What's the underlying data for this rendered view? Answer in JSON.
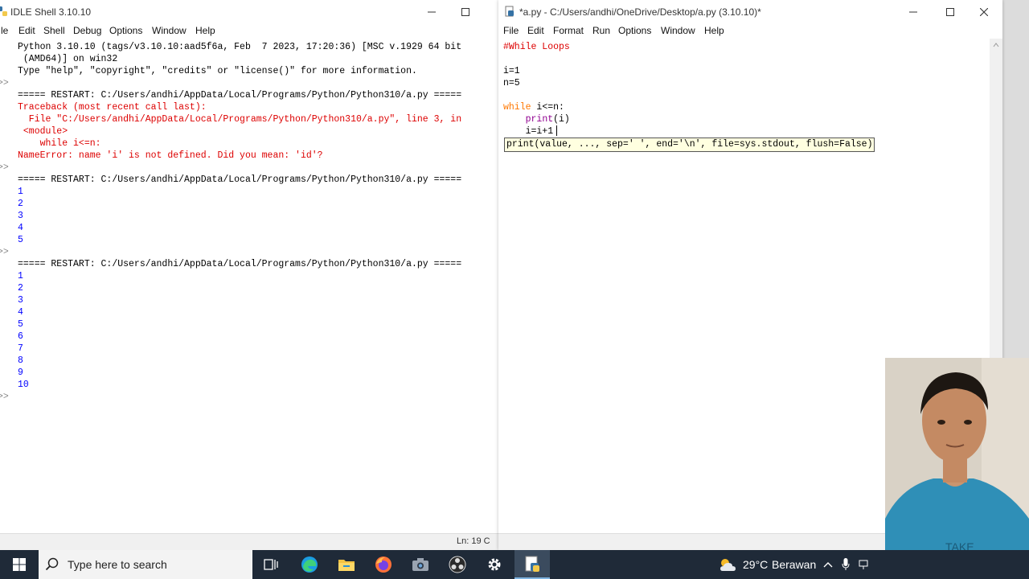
{
  "colors": {
    "keyword": "#ff7700",
    "comment": "#dd0000",
    "string": "#00aa00",
    "error": "#dd0000",
    "output": "#0000ff",
    "prompt": "#8a8a8a"
  },
  "shell": {
    "title": "IDLE Shell 3.10.10",
    "menu": [
      "le",
      "Edit",
      "Shell",
      "Debug",
      "Options",
      "Window",
      "Help"
    ],
    "status": "Ln: 19   C",
    "lines": [
      {
        "prompt": "",
        "text": "Python 3.10.10 (tags/v3.10.10:aad5f6a, Feb  7 2023, 17:20:36) [MSC v.1929 64 bit",
        "kind": "normal"
      },
      {
        "prompt": "",
        "text": " (AMD64)] on win32",
        "kind": "normal"
      },
      {
        "prompt": "",
        "text": "Type \"help\", \"copyright\", \"credits\" or \"license()\" for more information.",
        "kind": "normal"
      },
      {
        "prompt": ">>",
        "text": "",
        "kind": "normal"
      },
      {
        "prompt": "",
        "text": "===== RESTART: C:/Users/andhi/AppData/Local/Programs/Python/Python310/a.py =====",
        "kind": "normal"
      },
      {
        "prompt": "",
        "text": "Traceback (most recent call last):",
        "kind": "error"
      },
      {
        "prompt": "",
        "text": "  File \"C:/Users/andhi/AppData/Local/Programs/Python/Python310/a.py\", line 3, in",
        "kind": "error"
      },
      {
        "prompt": "",
        "text": " <module>",
        "kind": "error"
      },
      {
        "prompt": "",
        "text": "    while i<=n:",
        "kind": "error"
      },
      {
        "prompt": "",
        "text": "NameError: name 'i' is not defined. Did you mean: 'id'?",
        "kind": "error"
      },
      {
        "prompt": ">>",
        "text": "",
        "kind": "normal"
      },
      {
        "prompt": "",
        "text": "===== RESTART: C:/Users/andhi/AppData/Local/Programs/Python/Python310/a.py =====",
        "kind": "normal"
      },
      {
        "prompt": "",
        "text": "1",
        "kind": "output"
      },
      {
        "prompt": "",
        "text": "2",
        "kind": "output"
      },
      {
        "prompt": "",
        "text": "3",
        "kind": "output"
      },
      {
        "prompt": "",
        "text": "4",
        "kind": "output"
      },
      {
        "prompt": "",
        "text": "5",
        "kind": "output"
      },
      {
        "prompt": ">>",
        "text": "",
        "kind": "normal"
      },
      {
        "prompt": "",
        "text": "===== RESTART: C:/Users/andhi/AppData/Local/Programs/Python/Python310/a.py =====",
        "kind": "normal"
      },
      {
        "prompt": "",
        "text": "1",
        "kind": "output"
      },
      {
        "prompt": "",
        "text": "2",
        "kind": "output"
      },
      {
        "prompt": "",
        "text": "3",
        "kind": "output"
      },
      {
        "prompt": "",
        "text": "4",
        "kind": "output"
      },
      {
        "prompt": "",
        "text": "5",
        "kind": "output"
      },
      {
        "prompt": "",
        "text": "6",
        "kind": "output"
      },
      {
        "prompt": "",
        "text": "7",
        "kind": "output"
      },
      {
        "prompt": "",
        "text": "8",
        "kind": "output"
      },
      {
        "prompt": "",
        "text": "9",
        "kind": "output"
      },
      {
        "prompt": "",
        "text": "10",
        "kind": "output"
      },
      {
        "prompt": ">>",
        "text": "",
        "kind": "normal"
      }
    ]
  },
  "editor": {
    "title": "*a.py - C:/Users/andhi/OneDrive/Desktop/a.py (3.10.10)*",
    "menu": [
      "File",
      "Edit",
      "Format",
      "Run",
      "Options",
      "Window",
      "Help"
    ],
    "code": [
      {
        "segs": [
          {
            "t": "#While Loops",
            "c": "comment"
          }
        ]
      },
      {
        "segs": []
      },
      {
        "segs": [
          {
            "t": "i=1",
            "c": "normal"
          }
        ]
      },
      {
        "segs": [
          {
            "t": "n=5",
            "c": "normal"
          }
        ]
      },
      {
        "segs": []
      },
      {
        "segs": [
          {
            "t": "while",
            "c": "keyword"
          },
          {
            "t": " i<=n:",
            "c": "normal"
          }
        ]
      },
      {
        "segs": [
          {
            "t": "    ",
            "c": "normal"
          },
          {
            "t": "print",
            "c": "builtin"
          },
          {
            "t": "(i)",
            "c": "normal"
          }
        ]
      },
      {
        "segs": [
          {
            "t": "    i=i+1",
            "c": "normal"
          }
        ]
      }
    ],
    "calltip": "print(value, ..., sep=' ', end='\\n', file=sys.stdout, flush=False)"
  },
  "taskbar": {
    "search_placeholder": "Type here to search",
    "weather_temp": "29°C",
    "weather_desc": "Berawan",
    "apps": [
      "task-view-icon",
      "edge-icon",
      "file-explorer-icon",
      "firefox-icon",
      "camera-icon",
      "obs-icon",
      "settings-icon",
      "idle-icon"
    ]
  }
}
